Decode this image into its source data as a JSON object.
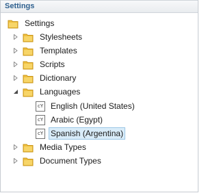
{
  "panel": {
    "title": "Settings"
  },
  "tree": {
    "root": {
      "label": "Settings",
      "icon": "folder-icon"
    },
    "items": [
      {
        "label": "Stylesheets",
        "icon": "folder-icon",
        "expander": "collapsed"
      },
      {
        "label": "Templates",
        "icon": "folder-icon",
        "expander": "collapsed"
      },
      {
        "label": "Scripts",
        "icon": "folder-icon",
        "expander": "collapsed"
      },
      {
        "label": "Dictionary",
        "icon": "folder-icon",
        "expander": "collapsed"
      },
      {
        "label": "Languages",
        "icon": "folder-icon",
        "expander": "expanded"
      },
      {
        "label": "Media Types",
        "icon": "folder-icon",
        "expander": "collapsed"
      },
      {
        "label": "Document Types",
        "icon": "folder-icon",
        "expander": "collapsed"
      }
    ],
    "languages": [
      {
        "label": "English (United States)",
        "icon": "language-document-icon"
      },
      {
        "label": "Arabic (Egypt)",
        "icon": "language-document-icon"
      },
      {
        "label": "Spanish (Argentina)",
        "icon": "language-document-icon",
        "selected": true
      }
    ]
  },
  "colors": {
    "header_title": "#2d5f8e",
    "selection_bg": "#d9ecf9",
    "selection_border": "#9cc7e6",
    "folder": "#e8b830"
  }
}
